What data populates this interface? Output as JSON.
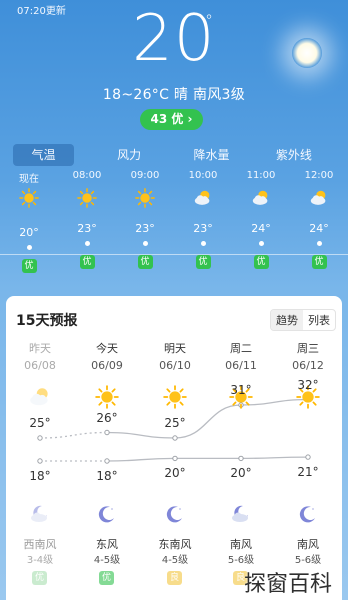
{
  "status": {
    "updated": "07:20更新"
  },
  "current": {
    "temp": "20",
    "degree_symbol": "°",
    "summary": "18~26°C 晴 南风3级",
    "aqi": "43 优 ›"
  },
  "tabs": [
    "气温",
    "风力",
    "降水量",
    "紫外线"
  ],
  "hourly": [
    {
      "time": "现在",
      "icon": "sun-icon",
      "temp": "20°",
      "aqi": "优"
    },
    {
      "time": "08:00",
      "icon": "sun-icon",
      "temp": "23°",
      "aqi": "优"
    },
    {
      "time": "09:00",
      "icon": "sun-icon",
      "temp": "23°",
      "aqi": "优"
    },
    {
      "time": "10:00",
      "icon": "cloud-sun-icon",
      "temp": "23°",
      "aqi": "优"
    },
    {
      "time": "11:00",
      "icon": "cloud-sun-icon",
      "temp": "24°",
      "aqi": "优"
    },
    {
      "time": "12:00",
      "icon": "cloud-sun-icon",
      "temp": "24°",
      "aqi": "优"
    }
  ],
  "forecast": {
    "title": "15天预报",
    "toggle": [
      "趋势",
      "列表"
    ],
    "days": [
      {
        "name": "昨天",
        "date": "06/08",
        "icon": "cloud-sun-icon",
        "high": "25°",
        "low": "18°",
        "night_icon": "cloud-moon-icon",
        "wind": "西南风",
        "level": "3-4级",
        "aqi": "优",
        "aqi_color": "#9fdca8"
      },
      {
        "name": "今天",
        "date": "06/09",
        "icon": "sun-icon",
        "high": "26°",
        "low": "18°",
        "night_icon": "moon-icon",
        "wind": "东风",
        "level": "4-5级",
        "aqi": "优",
        "aqi_color": "#33c24f"
      },
      {
        "name": "明天",
        "date": "06/10",
        "icon": "sun-icon",
        "high": "25°",
        "low": "20°",
        "night_icon": "moon-icon",
        "wind": "东南风",
        "level": "4-5级",
        "aqi": "良",
        "aqi_color": "#f2c12e"
      },
      {
        "name": "周二",
        "date": "06/11",
        "icon": "sun-icon",
        "high": "31°",
        "low": "20°",
        "night_icon": "cloud-moon-icon",
        "wind": "南风",
        "level": "5-6级",
        "aqi": "良",
        "aqi_color": "#f2c12e"
      },
      {
        "name": "周三",
        "date": "06/12",
        "icon": "sun-icon",
        "high": "32°",
        "low": "21°",
        "night_icon": "moon-icon",
        "wind": "南风",
        "level": "5-6级",
        "aqi": "",
        "aqi_color": "#33c24f"
      }
    ]
  },
  "watermark": "探窗百科",
  "colors": {
    "aqi_good": "#33c24f",
    "sky_top": "#3f8fd9",
    "sky_bottom": "#9ac8ef"
  }
}
